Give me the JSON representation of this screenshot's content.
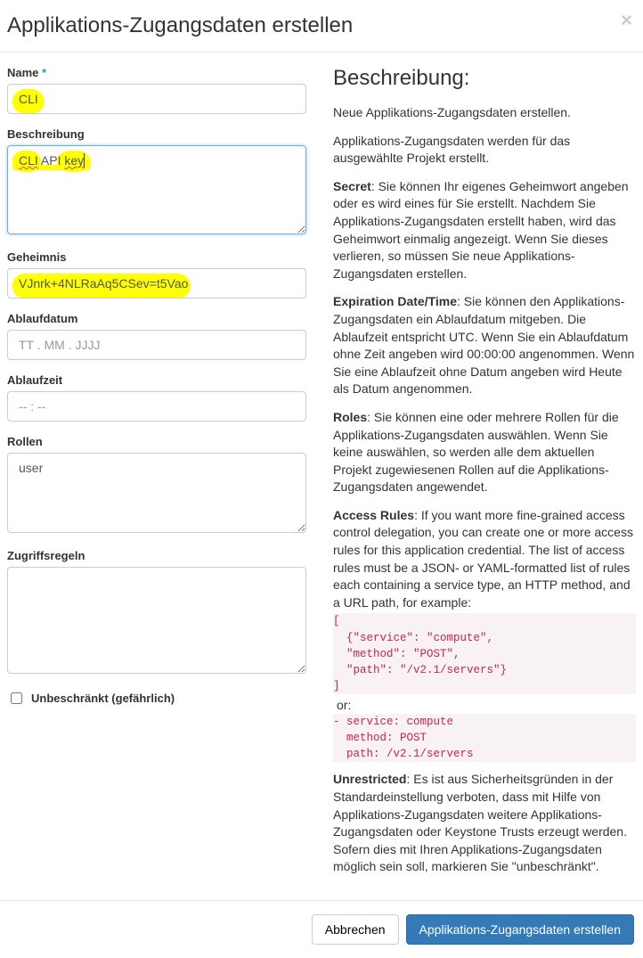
{
  "header": {
    "title": "Applikations-Zugangsdaten erstellen",
    "close_icon": "×"
  },
  "form": {
    "name_label": "Name",
    "name_value": "CLI",
    "desc_label": "Beschreibung",
    "desc_value_part1": "CLI",
    "desc_value_part2": " API ",
    "desc_value_part3": "key",
    "secret_label": "Geheimnis",
    "secret_value": "VJnrk+4NLRaAq5CSev=t5Vao",
    "expdate_label": "Ablaufdatum",
    "expdate_placeholder": "TT . MM . JJJJ",
    "exptime_label": "Ablaufzeit",
    "exptime_placeholder": "-- : --",
    "roles_label": "Rollen",
    "roles_value": "user",
    "rules_label": "Zugriffsregeln",
    "unrestricted_label": "Unbeschränkt (gefährlich)"
  },
  "help": {
    "heading": "Beschreibung:",
    "p1": "Neue Applikations-Zugangsdaten erstellen.",
    "p2": "Applikations-Zugangsdaten werden für das ausgewählte Projekt erstellt.",
    "p3_bold": "Secret",
    "p3_rest": ": Sie können Ihr eigenes Geheimwort angeben oder es wird eines für Sie erstellt. Nachdem Sie Applikations-Zugangsdaten erstellt haben, wird das Geheimwort einmalig angezeigt. Wenn Sie dieses verlieren, so müssen Sie neue Applikations-Zugangsdaten erstellen.",
    "p4_bold": "Expiration Date/Time",
    "p4_rest": ": Sie können den Applikations-Zugangsdaten ein Ablaufdatum mitgeben. Die Ablaufzeit entspricht UTC. Wenn Sie ein Ablaufdatum ohne Zeit angeben wird 00:00:00 angenommen. Wenn Sie eine Ablaufzeit ohne Datum angeben wird Heute als Datum angenommen.",
    "p5_bold": "Roles",
    "p5_rest": ": Sie können eine oder mehrere Rollen für die Applikations-Zugangsdaten auswählen. Wenn Sie keine auswählen, so werden alle dem aktuellen Projekt zugewiesenen Rollen auf die Applikations-Zugangsdaten angewendet.",
    "p6_bold": "Access Rules",
    "p6_rest": ": If you want more fine-grained access control delegation, you can create one or more access rules for this application credential. The list of access rules must be a JSON- or YAML-formatted list of rules each containing a service type, an HTTP method, and a URL path, for example:",
    "code1": "[\n  {\"service\": \"compute\",\n  \"method\": \"POST\",\n  \"path\": \"/v2.1/servers\"}\n]",
    "or_text": " or:",
    "code2": "- service: compute\n  method: POST\n  path: /v2.1/servers",
    "p7_bold": "Unrestricted",
    "p7_rest": ": Es ist aus Sicherheitsgründen in der Standardeinstellung verboten, dass mit Hilfe von Applikations-Zugangsdaten weitere Applikations-Zugangsdaten oder Keystone Trusts erzeugt werden. Sofern dies mit Ihren Applikations-Zugangsdaten möglich sein soll, markieren Sie \"unbeschränkt\"."
  },
  "footer": {
    "cancel_label": "Abbrechen",
    "submit_label": "Applikations-Zugangsdaten erstellen"
  }
}
